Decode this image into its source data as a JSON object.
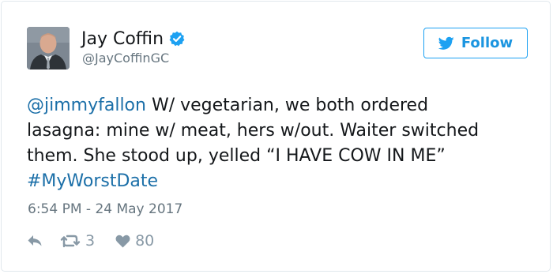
{
  "author": {
    "display_name": "Jay Coffin",
    "handle": "@JayCoffinGC",
    "verified": true,
    "avatar": "profile-photo"
  },
  "follow_button": {
    "label": "Follow",
    "icon": "twitter-bird-icon"
  },
  "tweet": {
    "lines": [
      [
        {
          "text": "@jimmyfallon",
          "link": true
        },
        {
          "text": " W/ vegetarian, we both ordered",
          "link": false
        }
      ],
      [
        {
          "text": "lasagna: mine w/ meat, hers w/out. Waiter switched",
          "link": false
        }
      ],
      [
        {
          "text": "them. She stood up, yelled “I HAVE COW IN ME”",
          "link": false
        }
      ],
      [
        {
          "text": "#MyWorstDate",
          "link": true
        }
      ]
    ],
    "timestamp": "6:54 PM - 24 May 2017"
  },
  "actions": {
    "reply_icon": "reply-icon",
    "retweet_icon": "retweet-icon",
    "retweet_count": "3",
    "like_icon": "heart-icon",
    "like_count": "80"
  },
  "colors": {
    "accent": "#1da1f2",
    "link": "#1b6fa8",
    "muted": "#66757f",
    "action": "#8899a6"
  }
}
